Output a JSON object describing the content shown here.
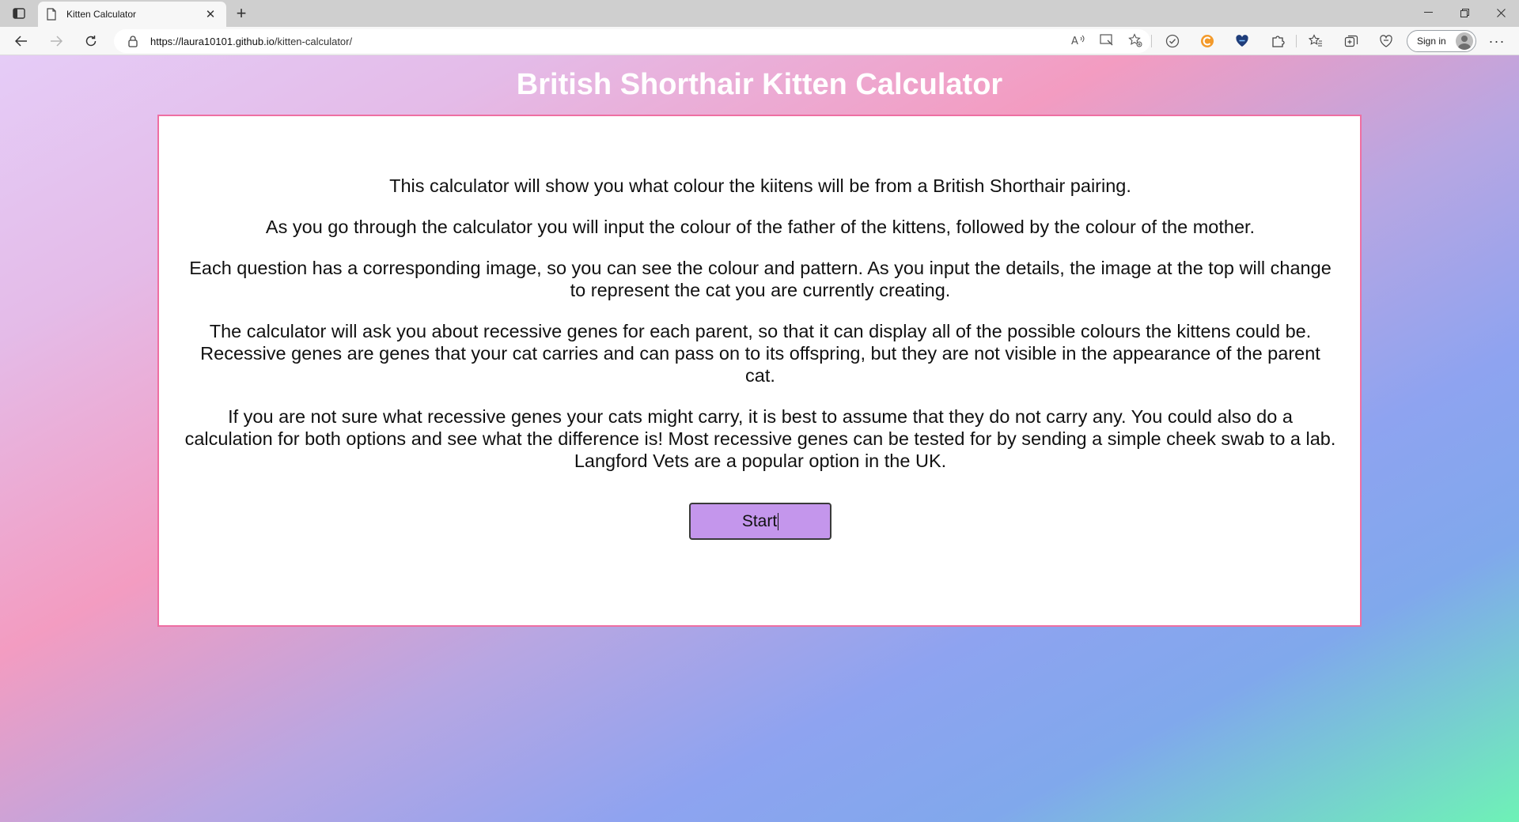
{
  "browser": {
    "tab_title": "Kitten Calculator",
    "url_host": "https://laura10101.github.io",
    "url_path": "/kitten-calculator/",
    "signin_label": "Sign in"
  },
  "page": {
    "title": "British Shorthair Kitten Calculator",
    "paragraphs": [
      "This calculator will show you what colour the kiitens will be from a British Shorthair pairing.",
      "As you go through the calculator you will input the colour of the father of the kittens, followed by the colour of the mother.",
      "Each question has a corresponding image, so you can see the colour and pattern. As you input the details, the image at the top will change to represent the cat you are currently creating.",
      "The calculator will ask you about recessive genes for each parent, so that it can display all of the possible colours the kittens could be. Recessive genes are genes that your cat carries and can pass on to its offspring, but they are not visible in the appearance of the parent cat.",
      "If you are not sure what recessive genes your cats might carry, it is best to assume that they do not carry any. You could also do a calculation for both options and see what the difference is! Most recessive genes can be tested for by sending a simple cheek swab to a lab. Langford Vets are a popular option in the UK."
    ],
    "start_label": "Start"
  },
  "colors": {
    "card_border": "#ee6fa2",
    "button_bg": "#c496ec"
  }
}
